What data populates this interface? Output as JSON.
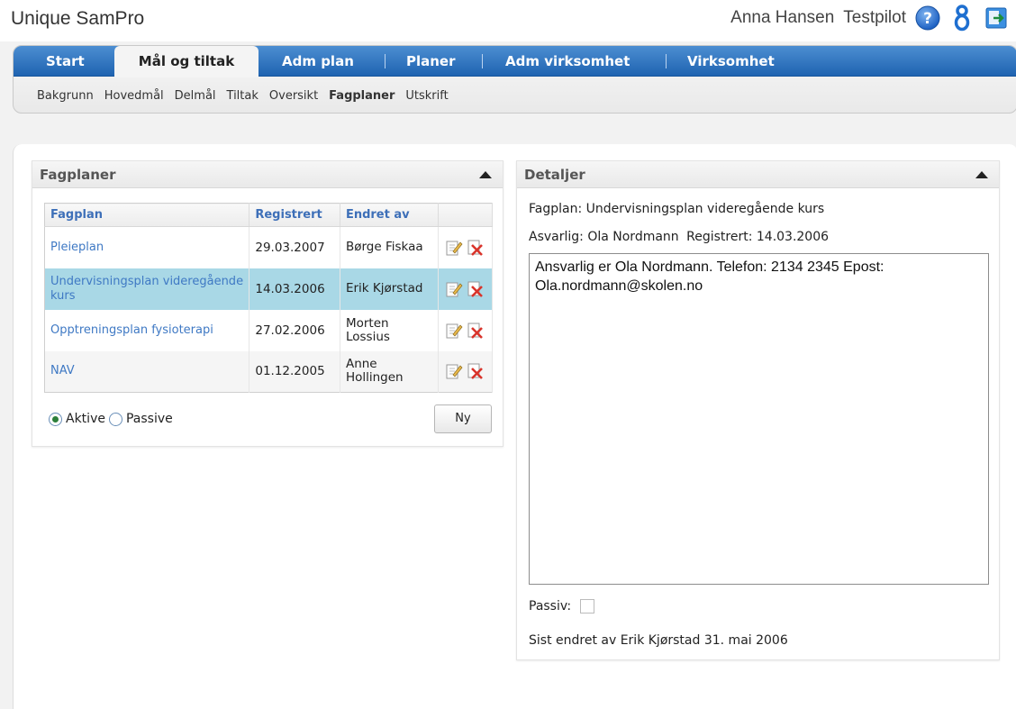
{
  "app": {
    "title": "Unique SamPro"
  },
  "user": {
    "name": "Anna Hansen",
    "role": "Testpilot"
  },
  "header_icons": [
    "help-icon",
    "accessibility-icon",
    "logout-icon"
  ],
  "nav": {
    "tabs": [
      {
        "label": "Start",
        "active": false
      },
      {
        "label": "Mål og tiltak",
        "active": true
      },
      {
        "label": "Adm plan",
        "active": false
      },
      {
        "label": "Planer",
        "active": false
      },
      {
        "label": "Adm virksomhet",
        "active": false
      },
      {
        "label": "Virksomhet",
        "active": false
      }
    ],
    "subtabs": [
      {
        "label": "Bakgrunn",
        "active": false
      },
      {
        "label": "Hovedmål",
        "active": false
      },
      {
        "label": "Delmål",
        "active": false
      },
      {
        "label": "Tiltak",
        "active": false
      },
      {
        "label": "Oversikt",
        "active": false
      },
      {
        "label": "Fagplaner",
        "active": true
      },
      {
        "label": "Utskrift",
        "active": false
      }
    ]
  },
  "fagplaner": {
    "title": "Fagplaner",
    "columns": [
      "Fagplan",
      "Registrert",
      "Endret av"
    ],
    "rows": [
      {
        "name": "Pleieplan",
        "date": "29.03.2007",
        "by": "Børge Fiskaa",
        "selected": false
      },
      {
        "name": "Undervisningsplan videregående kurs",
        "date": "14.03.2006",
        "by": "Erik Kjørstad",
        "selected": true
      },
      {
        "name": "Opptreningsplan fysioterapi",
        "date": "27.02.2006",
        "by": "Morten Lossius",
        "selected": false
      },
      {
        "name": "NAV",
        "date": "01.12.2005",
        "by": "Anne Hollingen",
        "selected": false
      }
    ],
    "filter": {
      "active_label": "Aktive",
      "passive_label": "Passive",
      "selected": "Aktive"
    },
    "new_button": "Ny"
  },
  "detaljer": {
    "title": "Detaljer",
    "fagplan_label": "Fagplan:",
    "fagplan_value": "Undervisningsplan videregående kurs",
    "ansvarlig_label": "Asvarlig:",
    "ansvarlig_value": "Ola Nordmann",
    "registrert_label": "Registrert:",
    "registrert_value": "14.03.2006",
    "notes": "Ansvarlig er Ola Nordmann. Telefon: 2134 2345 Epost: Ola.nordmann@skolen.no",
    "passiv_label": "Passiv:",
    "passiv_checked": false,
    "last_changed": "Sist endret av Erik Kjørstad 31. mai 2006"
  }
}
